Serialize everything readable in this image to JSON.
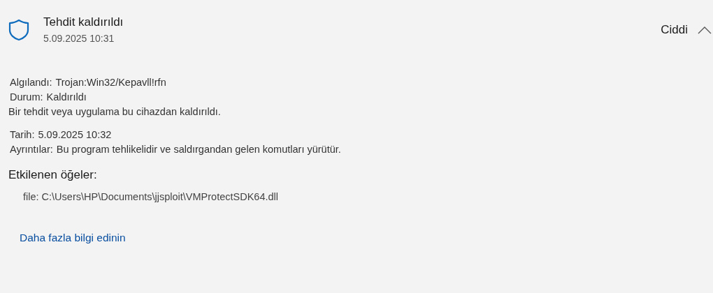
{
  "threat": {
    "title": "Tehdit kaldırıldı",
    "date": "5.09.2025 10:31",
    "severity": "Ciddi",
    "expanded": true
  },
  "details": [
    {
      "label": "Algılandı:",
      "value": "Trojan:Win32/Kepavll!rfn"
    },
    {
      "label": "Durum:",
      "value": "Kaldırıldı"
    }
  ],
  "status_message": "Bir tehdit veya uygulama bu cihazdan kaldırıldı.",
  "details_2": [
    {
      "label": "Tarih:",
      "value": "5.09.2025 10:32"
    },
    {
      "label": "Ayrıntılar:",
      "value": "Bu program tehlikelidir ve saldırgandan gelen komutları yürütür."
    }
  ],
  "affected_items": {
    "heading": "Etkilenen öğeler:",
    "items": [
      "file: C:\\Users\\HP\\Documents\\jjsploit\\VMProtectSDK64.dll"
    ]
  },
  "link": "Daha fazla bilgi edinin"
}
